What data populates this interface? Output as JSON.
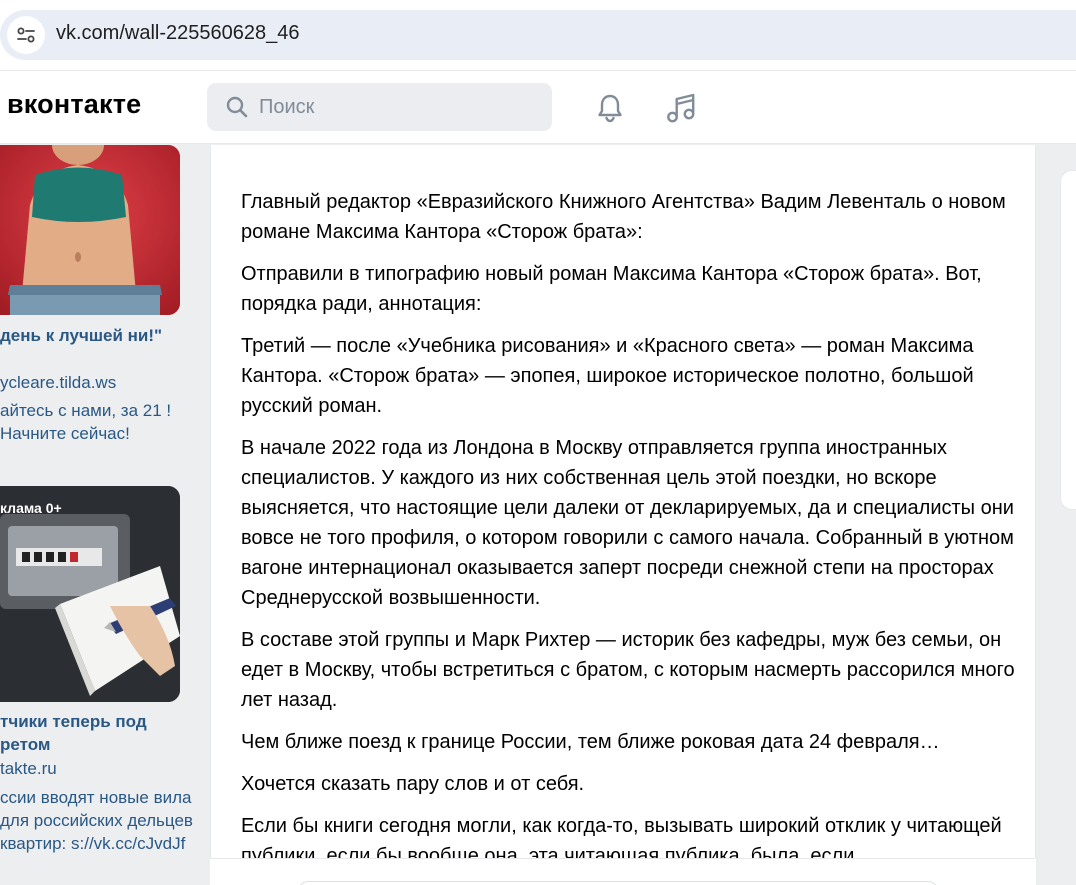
{
  "browser": {
    "url": "vk.com/wall-225560628_46"
  },
  "header": {
    "logo": "вконтакте",
    "search_placeholder": "Поиск"
  },
  "ads": [
    {
      "title": "день к лучшей ни!\"",
      "domain": "ycleare.tilda.ws",
      "text": "айтесь с нами, за 21 ! Начните сейчас!"
    },
    {
      "badge": "клама 0+",
      "title": "тчики теперь под ретом",
      "domain": "takte.ru",
      "text": "ссии вводят новые вила для российских дельцев квартир: s://vk.cc/cJvdJf"
    }
  ],
  "post": {
    "paragraphs": [
      "Главный редактор «Евразийского Книжного Агентства» Вадим Левенталь о новом романе Максима Кантора «Сторож брата»:",
      "Отправили в типографию новый роман Максима Кантора «Сторож брата». Вот, порядка ради, аннотация:",
      "Третий — после «Учебника рисования» и «Красного света» — роман Максима Кантора. «Сторож брата» — эпопея, широкое историческое полотно, большой русский роман.",
      "В начале 2022 года из Лондона в Москву отправляется группа иностранных специалистов. У каждого из них собственная цель этой поездки, но вскоре выясняется, что настоящие цели далеки от декларируемых, да и специалисты они вовсе не того профиля, о котором говорили с самого начала. Собранный в уютном вагоне интернационал оказывается заперт посреди снежной степи на просторах Среднерусской возвышенности.",
      "В составе этой группы и Марк Рихтер — историк без кафедры, муж без семьи, он едет в Москву, чтобы встретиться с братом, с которым насмерть рассорился много лет назад.",
      "Чем ближе поезд к границе России, тем ближе роковая дата 24 февраля…",
      "Хочется сказать пару слов и от себя.",
      "Если бы книги сегодня могли, как когда-то, вызывать широкий отклик у читающей публики, если бы вообще она, эта читающая публика, была, если"
    ]
  }
}
